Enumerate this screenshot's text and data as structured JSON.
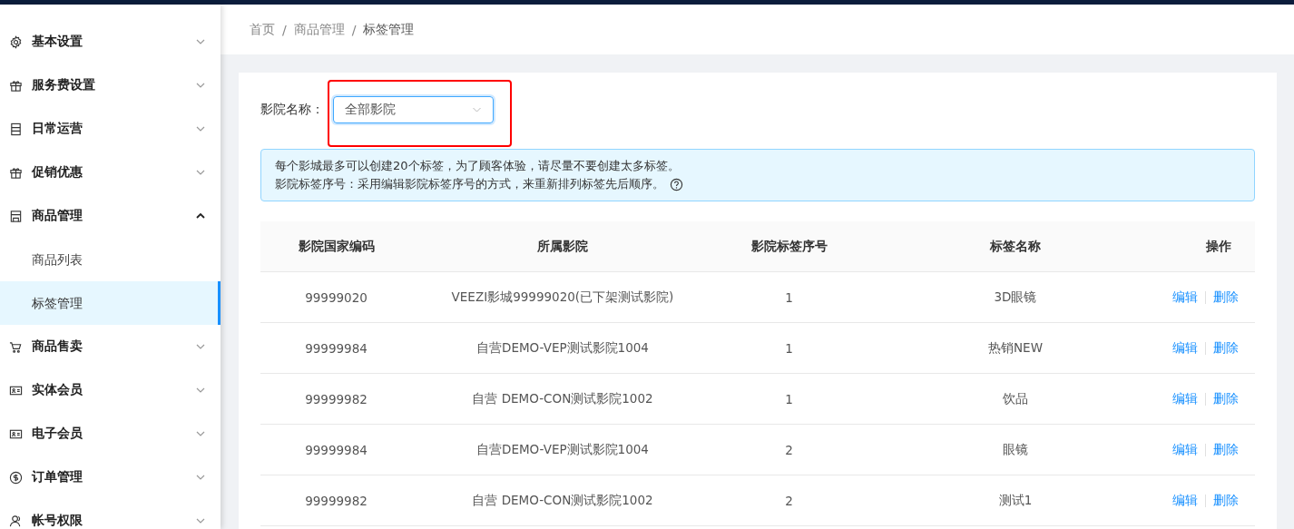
{
  "sidebar": {
    "items": [
      {
        "label": "基本设置",
        "expanded": false
      },
      {
        "label": "服务费设置",
        "expanded": false
      },
      {
        "label": "日常运营",
        "expanded": false
      },
      {
        "label": "促销优惠",
        "expanded": false
      },
      {
        "label": "商品管理",
        "expanded": true,
        "children": [
          {
            "label": "商品列表",
            "selected": false
          },
          {
            "label": "标签管理",
            "selected": true
          }
        ]
      },
      {
        "label": "商品售卖",
        "expanded": false
      },
      {
        "label": "实体会员",
        "expanded": false
      },
      {
        "label": "电子会员",
        "expanded": false
      },
      {
        "label": "订单管理",
        "expanded": false
      },
      {
        "label": "帐号权限",
        "expanded": false
      }
    ]
  },
  "breadcrumb": [
    {
      "label": "首页"
    },
    {
      "separator": "/",
      "label": "商品管理"
    },
    {
      "separator": "/",
      "label": "标签管理"
    }
  ],
  "filter": {
    "label": "影院名称：",
    "value": "全部影院",
    "highlighted": true
  },
  "notice": [
    "每个影城最多可以创建20个标签，为了顾客体验，请尽量不要创建太多标签。",
    "影院标签序号：采用编辑影院标签序号的方式，来重新排列标签先后顺序。"
  ],
  "table": {
    "columns": [
      "影院国家编码",
      "所属影院",
      "影院标签序号",
      "标签名称",
      "操作"
    ],
    "rows": [
      {
        "code": "99999020",
        "cinema": "VEEZI影城99999020(已下架测试影院)",
        "order": "1",
        "tag": "3D眼镜",
        "actions": [
          "编辑",
          "删除"
        ]
      },
      {
        "code": "99999984",
        "cinema": "自营DEMO-VEP测试影院1004",
        "order": "1",
        "tag": "热销NEW",
        "actions": [
          "编辑",
          "删除"
        ]
      },
      {
        "code": "99999982",
        "cinema": "自营 DEMO-CON测试影院1002",
        "order": "1",
        "tag": "饮品",
        "actions": [
          "编辑",
          "删除"
        ]
      },
      {
        "code": "99999984",
        "cinema": "自营DEMO-VEP测试影院1004",
        "order": "2",
        "tag": "眼镜",
        "actions": [
          "编辑",
          "删除"
        ]
      },
      {
        "code": "99999982",
        "cinema": "自营 DEMO-CON测试影院1002",
        "order": "2",
        "tag": "测试1",
        "actions": [
          "编辑",
          "删除"
        ]
      }
    ]
  }
}
